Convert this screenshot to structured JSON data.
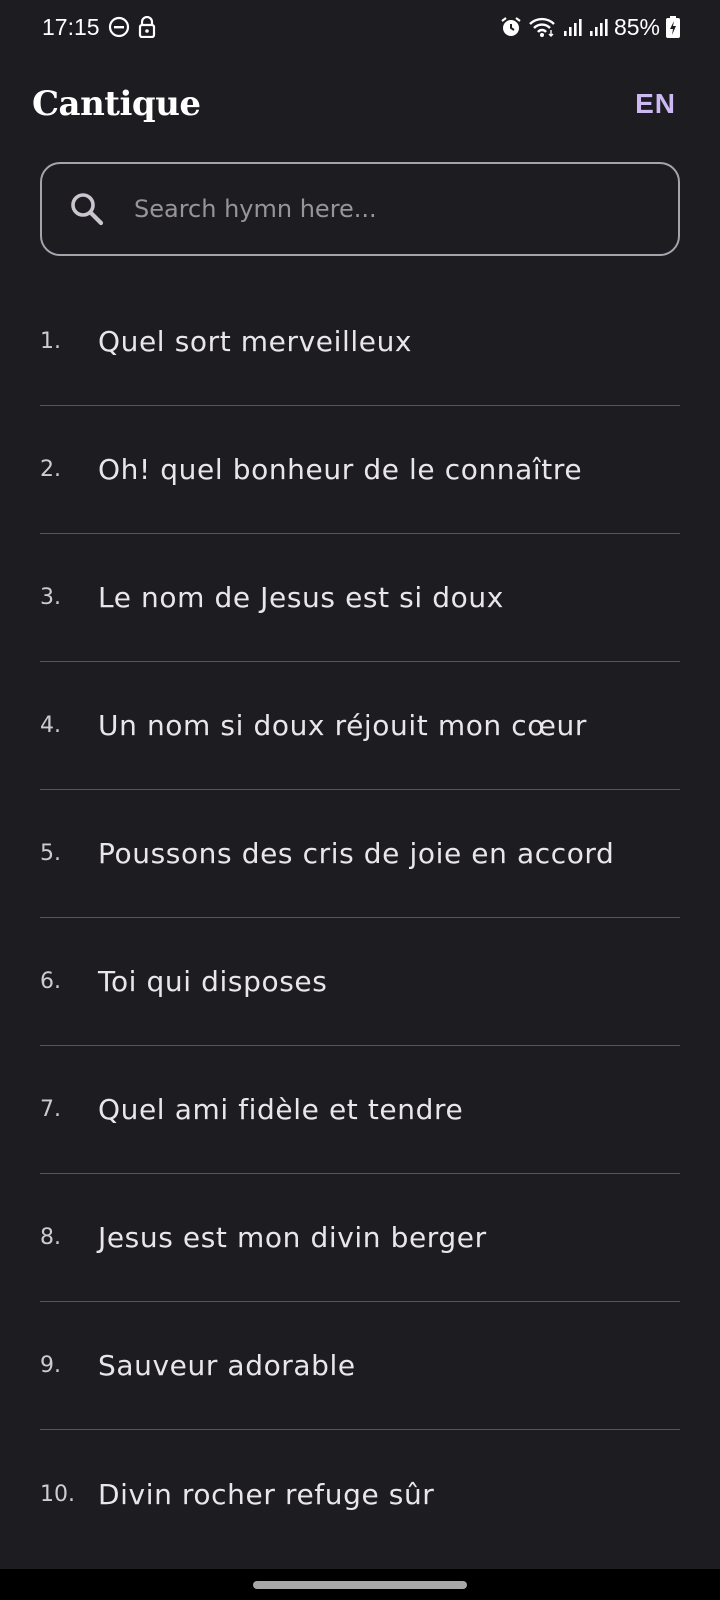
{
  "status_bar": {
    "time": "17:15",
    "battery": "85%",
    "icons_left": [
      "do-not-disturb-icon",
      "lock-icon"
    ],
    "icons_right": [
      "alarm-icon",
      "wifi-icon",
      "signal-icon",
      "signal-icon",
      "battery-charging-icon"
    ]
  },
  "app": {
    "title": "Cantique",
    "language_button": "EN",
    "accent": "#cdb8f4",
    "background": "#1d1c21"
  },
  "search": {
    "placeholder": "Search hymn here...",
    "value": "",
    "icon": "search-icon"
  },
  "hymns": [
    {
      "number": "1.",
      "title": "Quel sort merveilleux"
    },
    {
      "number": "2.",
      "title": "Oh! quel bonheur de le connaître"
    },
    {
      "number": "3.",
      "title": "Le nom de Jesus est si doux"
    },
    {
      "number": "4.",
      "title": "Un nom si doux réjouit mon cœur"
    },
    {
      "number": "5.",
      "title": "Poussons des cris de joie en accord"
    },
    {
      "number": "6.",
      "title": "Toi qui disposes"
    },
    {
      "number": "7.",
      "title": "Quel ami fidèle et tendre"
    },
    {
      "number": "8.",
      "title": "Jesus est mon divin berger"
    },
    {
      "number": "9.",
      "title": "Sauveur adorable"
    },
    {
      "number": "10.",
      "title": "Divin rocher refuge sûr"
    }
  ]
}
